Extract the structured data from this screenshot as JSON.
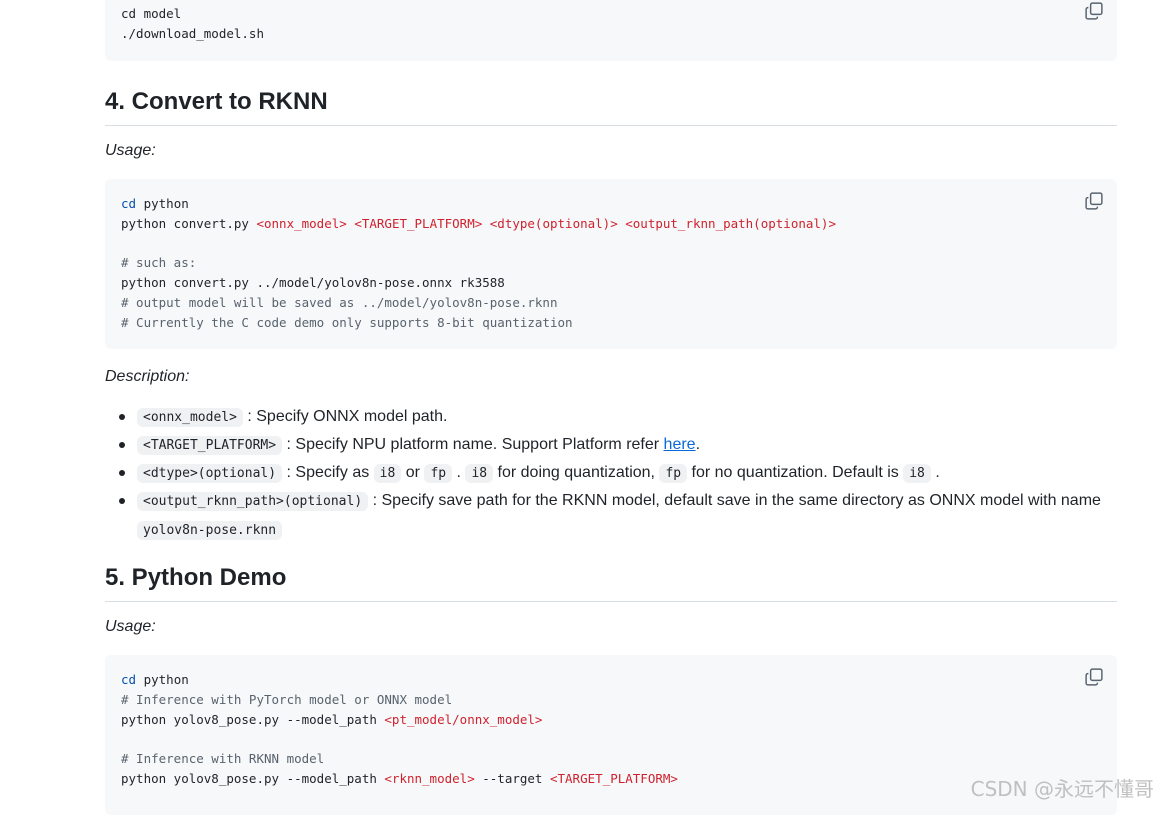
{
  "block1": {
    "lines": [
      "cd model",
      "./download_model.sh"
    ]
  },
  "section4": {
    "heading": "4. Convert to RKNN",
    "usage_label": "Usage:",
    "code": {
      "l1_kw": "cd",
      "l1_rest": " python",
      "l2_a": "python convert.py ",
      "l2_onnx": "<onnx_model>",
      "l2_sp1": " ",
      "l2_target": "<TARGET_PLATFORM>",
      "l2_sp2": " ",
      "l2_dtype": "<dtype(optional)>",
      "l2_sp3": " ",
      "l2_out": "<output_rknn_path(optional)>",
      "l4": "# such as:",
      "l5": "python convert.py ../model/yolov8n-pose.onnx rk3588",
      "l6": "# output model will be saved as ../model/yolov8n-pose.rknn",
      "l7": "# Currently the C code demo only supports 8-bit quantization"
    },
    "description_label": "Description:",
    "bullets": {
      "b1_code": "<onnx_model>",
      "b1_text": " : Specify ONNX model path.",
      "b2_code": "<TARGET_PLATFORM>",
      "b2_text": " : Specify NPU platform name. Support Platform refer ",
      "b2_link": "here",
      "b2_end": ".",
      "b3_code": "<dtype>(optional)",
      "b3_t1": " : Specify as ",
      "b3_c2": "i8",
      "b3_t2": " or ",
      "b3_c3": "fp",
      "b3_t3": " . ",
      "b3_c4": "i8",
      "b3_t4": " for doing quantization, ",
      "b3_c5": "fp",
      "b3_t5": " for no quantization. Default is ",
      "b3_c6": "i8",
      "b3_t6": " .",
      "b4_code": "<output_rknn_path>(optional)",
      "b4_text": " : Specify save path for the RKNN model, default save in the same directory as ONNX model with name",
      "b4_code2": "yolov8n-pose.rknn"
    }
  },
  "section5": {
    "heading": "5. Python Demo",
    "usage_label": "Usage:",
    "code": {
      "l1_kw": "cd",
      "l1_rest": " python",
      "l2": "# Inference with PyTorch model or ONNX model",
      "l3_a": "python yolov8_pose.py --model_path ",
      "l3_arg": "<pt_model/onnx_model>",
      "l5": "# Inference with RKNN model",
      "l6_a": "python yolov8_pose.py --model_path ",
      "l6_arg1": "<rknn_model>",
      "l6_b": " --target ",
      "l6_arg2": "<TARGET_PLATFORM>"
    }
  },
  "watermark": "CSDN @永远不懂哥",
  "icons": {
    "copy": "copy-icon"
  },
  "colors": {
    "keyword": "#0550ae",
    "angle_arg": "#cf222e",
    "comment": "#59636e",
    "link": "#0969da",
    "code_bg": "#f6f8fa"
  }
}
